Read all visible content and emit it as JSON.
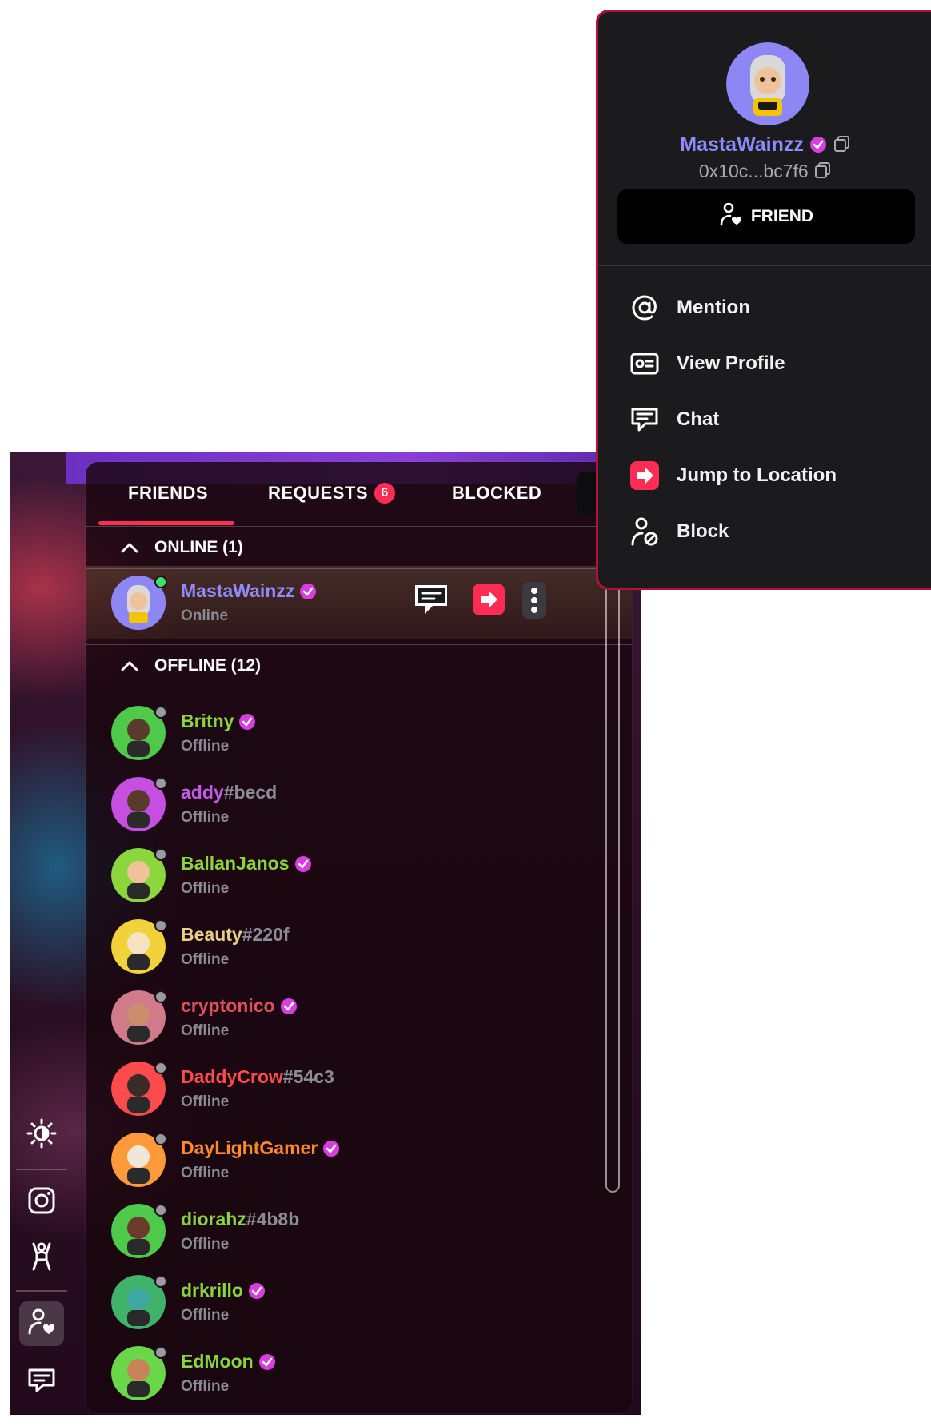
{
  "tabs": {
    "friends": "FRIENDS",
    "requests": "REQUESTS",
    "requests_count": "6",
    "blocked": "BLOCKED"
  },
  "sections": {
    "online": "ONLINE (1)",
    "offline": "OFFLINE (12)"
  },
  "online_friends": [
    {
      "name": "MastaWainzz",
      "tag": "",
      "status": "Online",
      "color": "#8f8bff",
      "verified": true
    }
  ],
  "offline_friends": [
    {
      "name": "Britny",
      "tag": "",
      "status": "Offline",
      "color": "#8ad63c",
      "verified": true
    },
    {
      "name": "addy",
      "tag": "#becd",
      "status": "Offline",
      "color": "#c25ce6",
      "verified": false
    },
    {
      "name": "BallanJanos",
      "tag": "",
      "status": "Offline",
      "color": "#8ad63c",
      "verified": true
    },
    {
      "name": "Beauty",
      "tag": "#220f",
      "status": "Offline",
      "color": "#e8d089",
      "verified": false
    },
    {
      "name": "cryptonico",
      "tag": "",
      "status": "Offline",
      "color": "#e0505a",
      "verified": true
    },
    {
      "name": "DaddyCrow",
      "tag": "#54c3",
      "status": "Offline",
      "color": "#ff4b4b",
      "verified": false
    },
    {
      "name": "DayLightGamer",
      "tag": "",
      "status": "Offline",
      "color": "#ff8a2a",
      "verified": true
    },
    {
      "name": "diorahz",
      "tag": "#4b8b",
      "status": "Offline",
      "color": "#8ad63c",
      "verified": false
    },
    {
      "name": "drkrillo",
      "tag": "",
      "status": "Offline",
      "color": "#8ad63c",
      "verified": true
    },
    {
      "name": "EdMoon",
      "tag": "",
      "status": "Offline",
      "color": "#8ad63c",
      "verified": true
    }
  ],
  "context_menu": {
    "name": "MastaWainzz",
    "address": "0x10c...bc7f6",
    "friend_button": "FRIEND",
    "items": [
      {
        "label": "Mention",
        "icon": "at-icon"
      },
      {
        "label": "View Profile",
        "icon": "profile-card-icon"
      },
      {
        "label": "Chat",
        "icon": "chat-icon"
      },
      {
        "label": "Jump to Location",
        "icon": "jump-icon"
      },
      {
        "label": "Block",
        "icon": "block-user-icon"
      }
    ]
  },
  "toolbar": {
    "icons": [
      "brightness-icon",
      "camera-icon",
      "emote-icon",
      "friends-icon",
      "chat-icon"
    ]
  },
  "colors": {
    "accent": "#ff2d55",
    "menu_bg": "#1b1b1d",
    "name_online": "#8f8bff"
  }
}
